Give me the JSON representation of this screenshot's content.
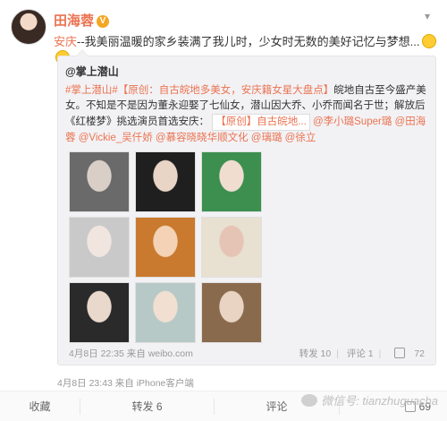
{
  "post": {
    "author": "田海蓉",
    "verified_badge": "V",
    "location_tag": "安庆",
    "text": "--我美丽温暖的家乡装满了我儿时，少女时无数的美好记忆与梦想...",
    "time_source": "4月8日 23:43 来自 iPhone客户端"
  },
  "repost": {
    "author": "@掌上潜山",
    "topic": "#掌上潜山#",
    "title": "【原创：自古皖地多美女，安庆籍女星大盘点】",
    "body": "皖地自古至今盛产美女。不知是不是因为董永迎娶了七仙女，潜山因大乔、小乔而闻名于世；解放后《红楼梦》挑选演员首选安庆：",
    "link_label": "【原创】自古皖地...",
    "mentions": "@李小璐Super璐 @田海蓉 @Vickie_吴仟娇 @慕容晓晓华顺文化 @璃璐 @徐立",
    "time_source": "4月8日 22:35 来自 weibo.com",
    "actions": {
      "repost": "转发 10",
      "comment": "评论 1",
      "like": "72"
    }
  },
  "photos": [
    {
      "name": "photo-1",
      "bg": "#6a6a6a",
      "fg": "#d9cfc7"
    },
    {
      "name": "photo-2",
      "bg": "#1f1f1f",
      "fg": "#e8d5c5"
    },
    {
      "name": "photo-3",
      "bg": "#3c8f4f",
      "fg": "#f0ddd0"
    },
    {
      "name": "photo-4",
      "bg": "#c9c9c9",
      "fg": "#f0e6df"
    },
    {
      "name": "photo-5",
      "bg": "#c97a2e",
      "fg": "#f3d2b5"
    },
    {
      "name": "photo-6",
      "bg": "#e8e0d0",
      "fg": "#e6c4b5"
    },
    {
      "name": "photo-7",
      "bg": "#2a2a2a",
      "fg": "#e9d8cc"
    },
    {
      "name": "photo-8",
      "bg": "#b7c9c7",
      "fg": "#f1dfd2"
    },
    {
      "name": "photo-9",
      "bg": "#8a6a4d",
      "fg": "#e9d3c2"
    }
  ],
  "bottom_bar": {
    "favorite": "收藏",
    "repost": "转发 6",
    "comment": "评论",
    "like": "69"
  },
  "watermark": "微信号: tianzhuguacha"
}
